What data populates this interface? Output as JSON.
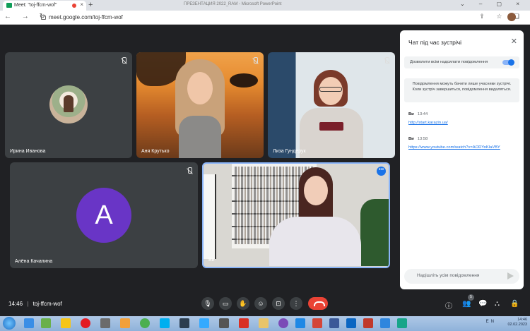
{
  "browser": {
    "tab_title": "Meet: \"toj-ffcm-wof\"",
    "tab_close": "×",
    "new_tab": "+",
    "window_title": "ПРЕЗЕНТАЦИЯ 2022_RAM - Microsoft PowerPoint",
    "window_controls": "⌄ – ▢ ×",
    "nav": "← → ↻",
    "url": "meet.google.com/toj-ffcm-wof",
    "right_icons": "⇪ ☆ ❑"
  },
  "tiles": [
    {
      "name": "Ирина Иванова"
    },
    {
      "name": "Аня Крутько"
    },
    {
      "name": "Лиза Гундерук"
    },
    {
      "name": "Алёна Качапина",
      "initial": "A"
    },
    {
      "name": "Ви",
      "more": "•••"
    }
  ],
  "chat": {
    "title": "Чат під час зустрічі",
    "close": "✕",
    "toggle_label": "Дозволити всім надсилати повідомлення",
    "toggle_on": true,
    "notice": "Повідомлення можуть бачити лише учасники зустрічі. Коли зустріч завершиться, повідомлення видаляться.",
    "messages": [
      {
        "sender": "Ви",
        "time": "13:44",
        "text": "http://start.karazin.ua/"
      },
      {
        "sender": "Ви",
        "time": "13:58",
        "text": "https://www.youtube.com/watch?v=AODYoKlaVBY"
      }
    ],
    "input_placeholder": "Надішліть усім повідомлення"
  },
  "bottom_bar": {
    "time": "14:46",
    "separator": "|",
    "meeting_code": "toj-ffcm-wof",
    "participants_count": "5",
    "colors": {
      "end_call": "#ea4335",
      "accent": "#1a73e8"
    }
  },
  "taskbar": {
    "clock_time": "14:46",
    "clock_date": "02.02.2023",
    "lang": "EN"
  }
}
